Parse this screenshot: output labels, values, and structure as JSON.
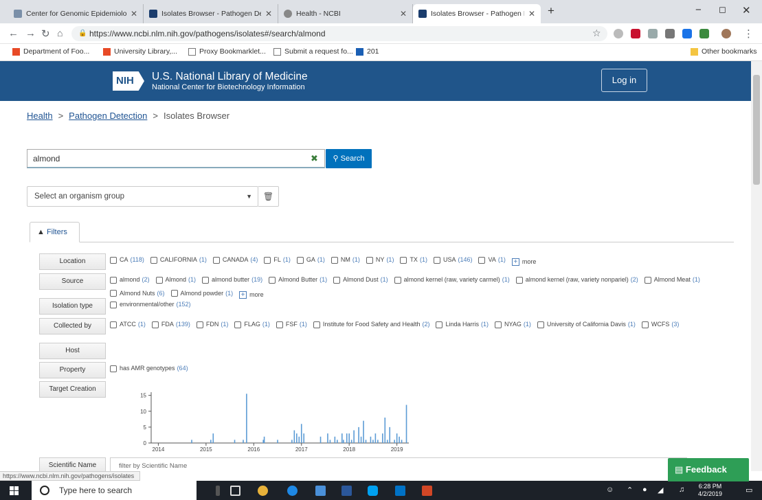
{
  "browser": {
    "tabs": [
      {
        "title": "Center for Genomic Epidemiolo",
        "active": false
      },
      {
        "title": "Isolates Browser - Pathogen Det",
        "active": false
      },
      {
        "title": "Health - NCBI",
        "active": false
      },
      {
        "title": "Isolates Browser - Pathogen Dete",
        "active": true
      }
    ],
    "new_tab": "+",
    "url": "https://www.ncbi.nlm.nih.gov/pathogens/isolates#/search/almond",
    "bookmarks": [
      "Department of Foo...",
      "University Library,...",
      "Proxy Bookmarklet...",
      "Submit a request fo...",
      "201"
    ],
    "other_bookmarks": "Other bookmarks"
  },
  "header": {
    "logo": "NIH",
    "title": "U.S. National Library of Medicine",
    "subtitle": "National Center for Biotechnology Information",
    "login": "Log in"
  },
  "breadcrumb": {
    "items": [
      "Health",
      "Pathogen Detection",
      "Isolates Browser"
    ],
    "separator": ">"
  },
  "search": {
    "value": "almond",
    "button": "Search"
  },
  "organism_select": {
    "placeholder": "Select an organism group"
  },
  "filters_tab": "Filters",
  "filters": {
    "location": {
      "label": "Location",
      "options": [
        {
          "name": "CA",
          "count": "(118)"
        },
        {
          "name": "CALIFORNIA",
          "count": "(1)"
        },
        {
          "name": "CANADA",
          "count": "(4)"
        },
        {
          "name": "FL",
          "count": "(1)"
        },
        {
          "name": "GA",
          "count": "(1)"
        },
        {
          "name": "NM",
          "count": "(1)"
        },
        {
          "name": "NY",
          "count": "(1)"
        },
        {
          "name": "TX",
          "count": "(1)"
        },
        {
          "name": "USA",
          "count": "(146)"
        },
        {
          "name": "VA",
          "count": "(1)"
        }
      ],
      "more": "more"
    },
    "source": {
      "label": "Source",
      "options": [
        {
          "name": "almond",
          "count": "(2)"
        },
        {
          "name": "Almond",
          "count": "(1)"
        },
        {
          "name": "almond butter",
          "count": "(19)"
        },
        {
          "name": "Almond Butter",
          "count": "(1)"
        },
        {
          "name": "Almond Dust",
          "count": "(1)"
        },
        {
          "name": "almond kernel (raw, variety carmel)",
          "count": "(1)"
        },
        {
          "name": "almond kernel (raw, variety nonpariel)",
          "count": "(2)"
        },
        {
          "name": "Almond Meat",
          "count": "(1)"
        },
        {
          "name": "Almond Nuts",
          "count": "(6)"
        },
        {
          "name": "Almond powder",
          "count": "(1)"
        }
      ],
      "more": "more"
    },
    "isolation_type": {
      "label": "Isolation type",
      "options": [
        {
          "name": "environmental/other",
          "count": "(152)"
        }
      ]
    },
    "collected_by": {
      "label": "Collected by",
      "options": [
        {
          "name": "ATCC",
          "count": "(1)"
        },
        {
          "name": "FDA",
          "count": "(139)"
        },
        {
          "name": "FDN",
          "count": "(1)"
        },
        {
          "name": "FLAG",
          "count": "(1)"
        },
        {
          "name": "FSF",
          "count": "(1)"
        },
        {
          "name": "Institute for Food Safety and Health",
          "count": "(2)"
        },
        {
          "name": "Linda Harris",
          "count": "(1)"
        },
        {
          "name": "NYAG",
          "count": "(1)"
        },
        {
          "name": "University of California Davis",
          "count": "(1)"
        },
        {
          "name": "WCFS",
          "count": "(3)"
        }
      ]
    },
    "host": {
      "label": "Host"
    },
    "property": {
      "label": "Property",
      "options": [
        {
          "name": "has AMR genotypes",
          "count": "(64)"
        }
      ]
    },
    "target_creation": {
      "label": "Target Creation"
    },
    "scientific_name": {
      "label": "Scientific Name",
      "placeholder": "filter by Scientific Name"
    }
  },
  "chart_data": {
    "type": "bar",
    "title": "",
    "xlabel": "",
    "ylabel": "",
    "ylim": [
      0,
      16
    ],
    "xlim": [
      2013.85,
      2019.25
    ],
    "xticks": [
      "2014",
      "2015",
      "2016",
      "2017",
      "2018",
      "2019"
    ],
    "yticks": [
      "0",
      "5",
      "10",
      "15"
    ],
    "x": [
      2014.7,
      2015.1,
      2015.15,
      2015.6,
      2015.78,
      2015.85,
      2016.2,
      2016.22,
      2016.5,
      2016.8,
      2016.85,
      2016.9,
      2016.95,
      2017.0,
      2017.05,
      2017.4,
      2017.55,
      2017.6,
      2017.7,
      2017.75,
      2017.85,
      2017.88,
      2017.95,
      2018.0,
      2018.05,
      2018.1,
      2018.2,
      2018.25,
      2018.3,
      2018.35,
      2018.45,
      2018.5,
      2018.55,
      2018.6,
      2018.7,
      2018.75,
      2018.8,
      2018.85,
      2018.95,
      2019.0,
      2019.05,
      2019.1,
      2019.2
    ],
    "values": [
      1,
      1,
      3,
      1,
      1,
      15.5,
      1,
      2,
      1,
      1,
      4,
      3,
      2,
      6,
      3,
      2,
      3,
      1,
      2,
      1,
      3,
      1,
      3,
      3,
      1,
      4,
      5,
      2,
      7,
      1,
      2,
      1,
      3,
      1,
      3,
      8,
      1,
      5,
      1,
      3,
      2,
      1,
      12
    ]
  },
  "status_url": "https://www.ncbi.nlm.nih.gov/pathogens/isolates",
  "feedback": "Feedback",
  "taskbar": {
    "search_placeholder": "Type here to search",
    "time": "6:28 PM",
    "date": "4/2/2019"
  }
}
